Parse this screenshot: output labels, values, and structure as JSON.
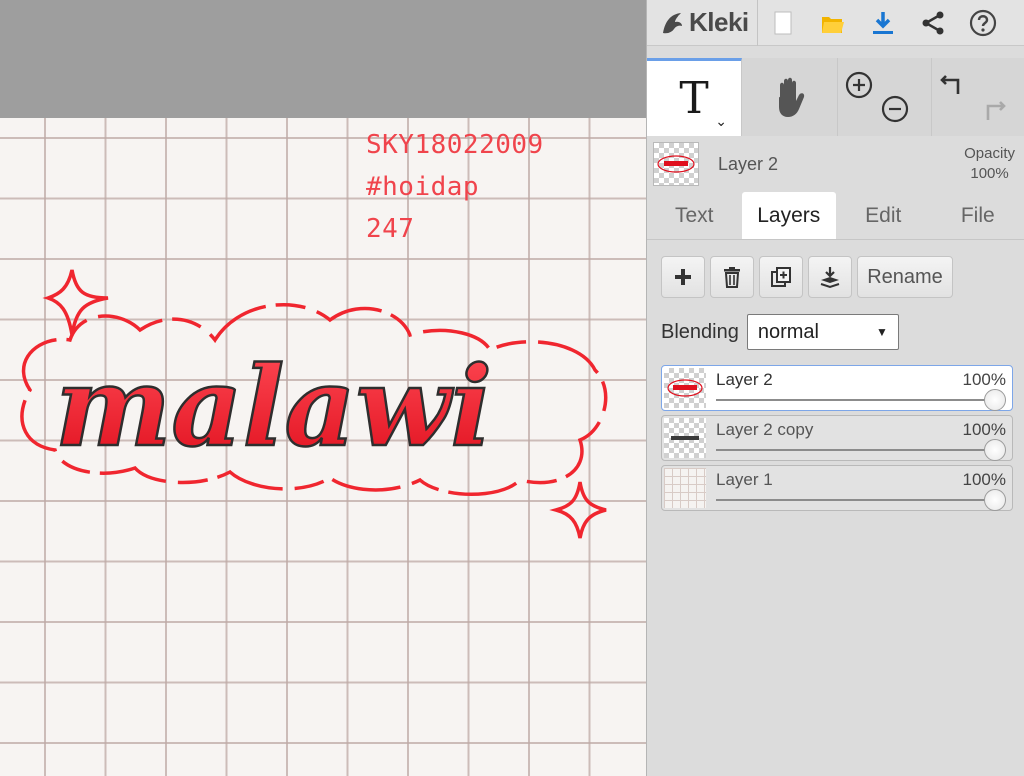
{
  "app": {
    "logo_text": "Kleki"
  },
  "topbar": {
    "buttons": [
      {
        "icon": "new-file-icon"
      },
      {
        "icon": "open-folder-icon"
      },
      {
        "icon": "download-icon"
      },
      {
        "icon": "share-icon"
      },
      {
        "icon": "help-icon"
      }
    ]
  },
  "canvas": {
    "handwritten_lines": [
      "SKY18022009",
      "#hoidap",
      "247"
    ],
    "lettering": "malawi",
    "colors": {
      "accent": "#f0444c",
      "ink": "#2e2e2e",
      "paper": "#f7f4f2"
    }
  },
  "tools": {
    "text_glyph": "T",
    "text_caret": "⌄",
    "icons": [
      "text-tool-icon",
      "hand-tool-icon",
      "zoom-in-icon",
      "zoom-out-icon",
      "undo-icon",
      "redo-icon"
    ]
  },
  "current_layer": {
    "name": "Layer 2",
    "opacity_label": "Opacity",
    "opacity_value": "100%"
  },
  "tabs": [
    {
      "label": "Text",
      "active": false
    },
    {
      "label": "Layers",
      "active": true
    },
    {
      "label": "Edit",
      "active": false
    },
    {
      "label": "File",
      "active": false
    }
  ],
  "layer_actions": {
    "icons": [
      "add-layer-icon",
      "delete-layer-icon",
      "duplicate-layer-icon",
      "merge-down-icon"
    ],
    "rename_label": "Rename"
  },
  "blending": {
    "label": "Blending",
    "value": "normal"
  },
  "layers": [
    {
      "name": "Layer 2",
      "opacity": "100%",
      "opacity_fraction": 1.0,
      "active": true
    },
    {
      "name": "Layer 2 copy",
      "opacity": "100%",
      "opacity_fraction": 1.0,
      "active": false
    },
    {
      "name": "Layer 1",
      "opacity": "100%",
      "opacity_fraction": 1.0,
      "active": false
    }
  ]
}
